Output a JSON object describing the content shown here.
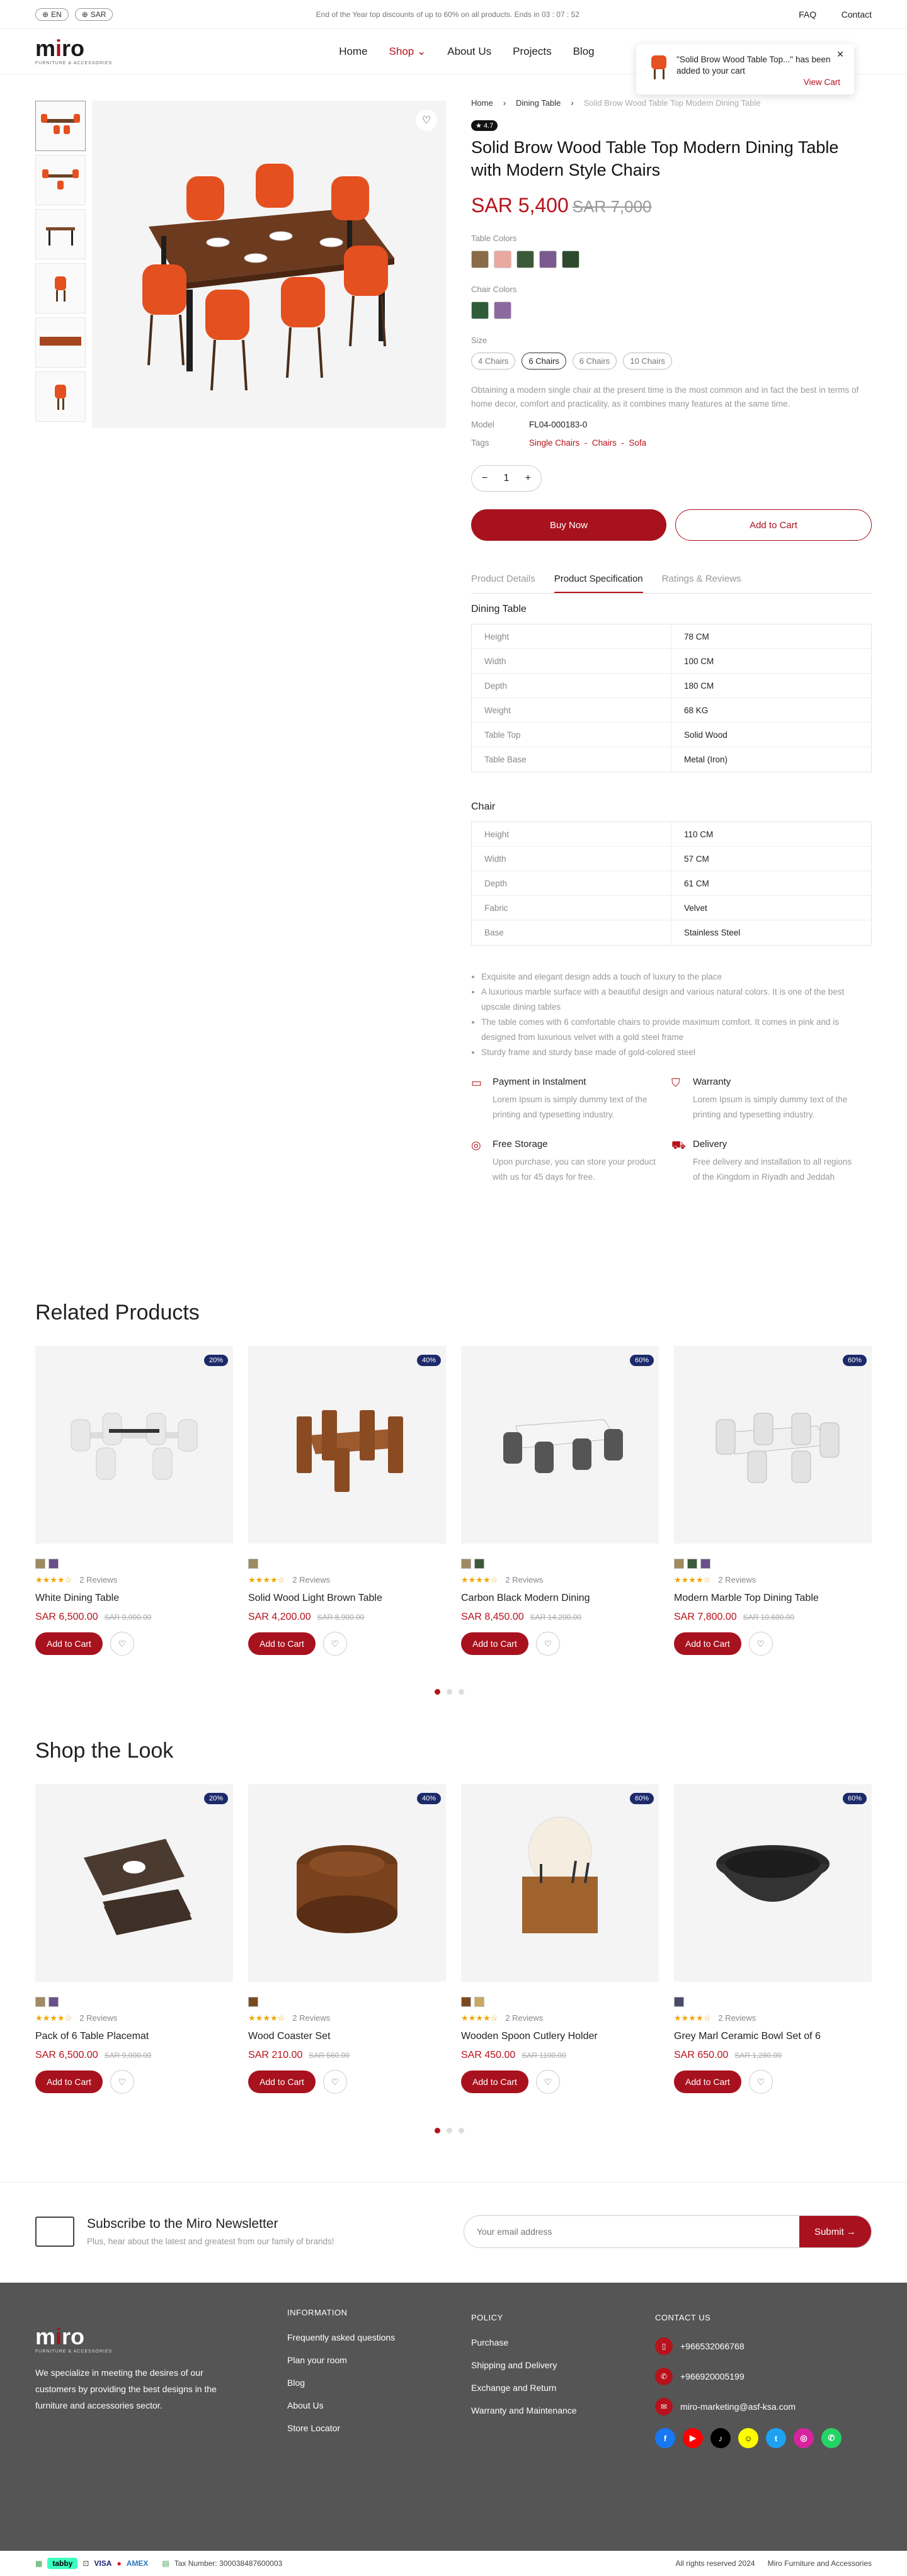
{
  "topbar": {
    "lang": "EN",
    "currency": "SAR",
    "promo": "End of the Year top discounts of up to 60% on all products. Ends in 03 : 07 : 52",
    "links": [
      "FAQ",
      "Contact"
    ]
  },
  "header": {
    "logo": "miro",
    "logo_sub": "FURNITURE & ACCESSORIES",
    "nav": [
      "Home",
      "Shop",
      "About Us",
      "Projects",
      "Blog"
    ]
  },
  "toast": {
    "message": "\"Solid Brow Wood Table Top...\" has been added to your cart",
    "view": "View Cart"
  },
  "breadcrumb": [
    "Home",
    "Dining Table",
    "Solid Brow Wood Table Top Modern Dining Table"
  ],
  "product": {
    "rating": "4.7",
    "title": "Solid Brow Wood Table Top Modern Dining Table with Modern Style Chairs",
    "price": "SAR 5,400",
    "old_price": "SAR 7,000",
    "table_colors_label": "Table Colors",
    "table_colors": [
      "#8a6b45",
      "#e9a9a0",
      "#3c5a3a",
      "#7b5a8f",
      "#2e4a2e"
    ],
    "chair_colors_label": "Chair Colors",
    "chair_colors": [
      "#2f5d3a",
      "#8c6aa0"
    ],
    "size_label": "Size",
    "sizes": [
      "4 Chairs",
      "6 Chairs",
      "6 Chairs",
      "10 Chairs"
    ],
    "description": "Obtaining a modern single chair at the present time is the most common and in fact the best in terms of home decor, comfort and practicality, as it combines many features at the same time.",
    "model_label": "Model",
    "model": "FL04-000183-0",
    "tags_label": "Tags",
    "tags": [
      "Single Chairs",
      "Chairs",
      "Sofa"
    ],
    "qty": "1",
    "buy": "Buy Now",
    "add": "Add to Cart"
  },
  "tabs": [
    "Product Details",
    "Product Specification",
    "Ratings & Reviews"
  ],
  "spec": {
    "table_title": "Dining Table",
    "table": [
      [
        "Height",
        "78 CM"
      ],
      [
        "Width",
        "100 CM"
      ],
      [
        "Depth",
        "180 CM"
      ],
      [
        "Weight",
        "68 KG"
      ],
      [
        "Table Top",
        "Solid Wood"
      ],
      [
        "Table Base",
        "Metal (Iron)"
      ]
    ],
    "chair_title": "Chair",
    "chair": [
      [
        "Height",
        "110 CM"
      ],
      [
        "Width",
        "57 CM"
      ],
      [
        "Depth",
        "61 CM"
      ],
      [
        "Fabric",
        "Velvet"
      ],
      [
        "Base",
        "Stainless Steel"
      ]
    ],
    "bullets": [
      "Exquisite and elegant design adds a touch of luxury to the place",
      "A luxurious marble surface with a beautiful design and various natural colors. It is one of the best upscale dining tables",
      "The table comes with 6 comfortable chairs to provide maximum comfort. It comes in pink and is designed from luxurious velvet with a gold steel frame",
      "Sturdy frame and sturdy base made of gold-colored steel"
    ]
  },
  "features": [
    {
      "title": "Payment in Instalment",
      "desc": "Lorem Ipsum is simply dummy text of the printing and typesetting industry."
    },
    {
      "title": "Warranty",
      "desc": "Lorem Ipsum is simply dummy text of the printing and typesetting industry."
    },
    {
      "title": "Free Storage",
      "desc": "Upon purchase, you can store your product with us for 45 days for free."
    },
    {
      "title": "Delivery",
      "desc": "Free delivery and installation to all regions of the Kingdom in Riyadh and Jeddah"
    }
  ],
  "related": {
    "title": "Related Products",
    "items": [
      {
        "discount": "20%",
        "name": "White Dining Table",
        "price": "SAR 6,500.00",
        "old": "SAR 9,000.00",
        "reviews": "2 Reviews",
        "swatches": [
          "#a08a60",
          "#6a4f8a"
        ]
      },
      {
        "discount": "40%",
        "name": "Solid Wood Light Brown Table",
        "price": "SAR 4,200.00",
        "old": "SAR 8,900.00",
        "reviews": "2 Reviews",
        "swatches": [
          "#a08a60"
        ]
      },
      {
        "discount": "60%",
        "name": "Carbon Black Modern Dining",
        "price": "SAR 8,450.00",
        "old": "SAR 14,200.00",
        "reviews": "2 Reviews",
        "swatches": [
          "#a08a60",
          "#3b5a3b"
        ]
      },
      {
        "discount": "60%",
        "name": "Modern Marble Top Dining Table",
        "price": "SAR 7,800.00",
        "old": "SAR 10,600.00",
        "reviews": "2 Reviews",
        "swatches": [
          "#a08a60",
          "#3b5a3b",
          "#6a4f8a"
        ]
      }
    ]
  },
  "look": {
    "title": "Shop the Look",
    "items": [
      {
        "discount": "20%",
        "name": "Pack of 6 Table Placemat",
        "price": "SAR 6,500.00",
        "old": "SAR 9,000.00",
        "reviews": "2 Reviews",
        "swatches": [
          "#a08a60",
          "#6a4f8a"
        ]
      },
      {
        "discount": "40%",
        "name": "Wood Coaster Set",
        "price": "SAR 210.00",
        "old": "SAR 560.00",
        "reviews": "2 Reviews",
        "swatches": [
          "#7a4a20"
        ]
      },
      {
        "discount": "60%",
        "name": "Wooden Spoon Cutlery Holder",
        "price": "SAR 450.00",
        "old": "SAR 1100.00",
        "reviews": "2 Reviews",
        "swatches": [
          "#7a4a20",
          "#c9a860"
        ]
      },
      {
        "discount": "60%",
        "name": "Grey Marl Ceramic Bowl Set of 6",
        "price": "SAR 650.00",
        "old": "SAR 1,280.00",
        "reviews": "2 Reviews",
        "swatches": [
          "#4a4a6a"
        ]
      }
    ]
  },
  "card_btn": "Add to Cart",
  "newsletter": {
    "title": "Subscribe to the Miro Newsletter",
    "desc": "Plus, hear about the latest and greatest from our family of brands!",
    "placeholder": "Your email address",
    "submit": "Submit"
  },
  "footer": {
    "about": "We specialize in meeting the desires of our customers by providing the best designs in the furniture and accessories sector.",
    "info_title": "INFORMATION",
    "info": [
      "Frequently asked questions",
      "Plan your room",
      "Blog",
      "About Us",
      "Store Locator"
    ],
    "policy_title": "POLICY",
    "policy": [
      "Purchase",
      "Shipping and Delivery",
      "Exchange and Return",
      "Warranty and Maintenance"
    ],
    "contact_title": "CONTACT US",
    "contact": [
      "+966532066768",
      "+966920005199",
      "miro-marketing@asf-ksa.com"
    ]
  },
  "bottom": {
    "tax": "Tax Number: 300038487600003",
    "rights": "All rights reserved 2024",
    "company": "Miro Furniture and Accessories",
    "tabby": "tabby"
  }
}
